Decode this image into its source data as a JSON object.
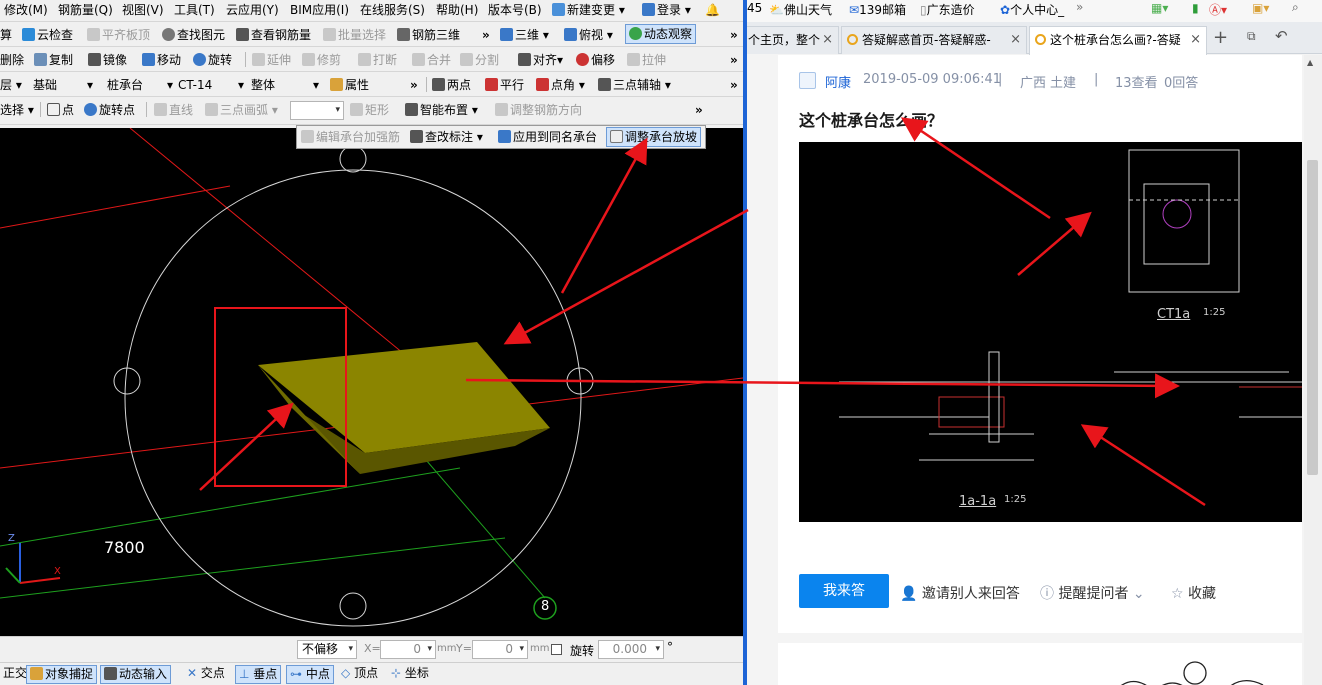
{
  "left_app": {
    "menu": [
      "修改(M)",
      "钢筋量(Q)",
      "视图(V)",
      "工具(T)",
      "云应用(Y)",
      "BIM应用(I)",
      "在线服务(S)",
      "帮助(H)",
      "版本号(B)",
      "新建变更",
      "登录"
    ],
    "row2": {
      "calc": "算",
      "cloud_check": "云检查",
      "flat_slab": "平齐板顶",
      "find_element": "查找图元",
      "view_rebar": "查看钢筋量",
      "batch_select": "批量选择",
      "rebar_3d": "钢筋三维",
      "three_d": "三维",
      "top_view": "俯视",
      "dynamic_view": "动态观察"
    },
    "row3": {
      "delete": "删除",
      "copy": "复制",
      "mirror": "镜像",
      "move": "移动",
      "rotate": "旋转",
      "extend": "延伸",
      "trim": "修剪",
      "break": "打断",
      "merge": "合并",
      "split": "分割",
      "align": "对齐",
      "offset": "偏移",
      "stretch": "拉伸"
    },
    "row4": {
      "floor": "层",
      "category": "基础",
      "type": "桩承台",
      "name": "CT-14",
      "scope": "整体",
      "properties": "属性",
      "two_points": "两点",
      "parallel": "平行",
      "point_angle": "点角",
      "three_point_axis": "三点辅轴"
    },
    "row5": {
      "select": "选择",
      "point": "点",
      "rotate_point": "旋转点",
      "line": "直线",
      "arc": "三点画弧",
      "rect": "矩形",
      "smart_layout": "智能布置",
      "adjust_rebar_dir": "调整钢筋方向"
    },
    "popup": {
      "edit_cap_rebar": "编辑承台加强筋",
      "modify_label": "查改标注",
      "apply_same_name": "应用到同名承台",
      "adjust_slope": "调整承台放坡"
    },
    "viewport": {
      "dimension": "7800",
      "axis_label": "8",
      "axis_z": "Z",
      "axis_x": "X"
    },
    "status": {
      "offset_mode": "不偏移",
      "x_label": "X=",
      "x_value": "0",
      "y_label": "Y=",
      "y_value": "0",
      "unit": "mm",
      "rotate_label": "旋转",
      "rotate_value": "0.000",
      "degree": "°"
    },
    "snap": {
      "ortho": "正交",
      "object_snap": "对象捕捉",
      "dynamic_input": "动态输入",
      "intersection": "交点",
      "perpendicular": "垂点",
      "midpoint": "中点",
      "vertex": "顶点",
      "coordinate": "坐标"
    }
  },
  "browser": {
    "bookmarks": [
      "45",
      "佛山天气",
      "139邮箱",
      "广东造价",
      "个人中心_"
    ],
    "tabs": [
      {
        "label": "个主页，整个",
        "close": "×"
      },
      {
        "label": "答疑解惑首页-答疑解惑-",
        "close": "×"
      },
      {
        "label": "这个桩承台怎么画?-答疑",
        "close": "×"
      }
    ],
    "new_tab": "+",
    "question": {
      "author": "阿康",
      "datetime": "2019-05-09 09:06:41",
      "region": "广西",
      "category": "土建",
      "views": "13查看",
      "answers": "0回答",
      "title": "这个桩承台怎么画？"
    },
    "drawing": {
      "plan_label": "CT1a",
      "plan_scale": "1:25",
      "section_label": "1a-1a",
      "section_scale": "1:25"
    },
    "actions": {
      "answer": "我来答",
      "invite": "邀请别人来回答",
      "remind": "提醒提问者",
      "favorite": "收藏"
    }
  },
  "colors": {
    "accent_blue": "#0a84ee",
    "cap_olive": "#8b8500",
    "annotation_red": "#e8151b",
    "divider": "#1d64d6"
  }
}
